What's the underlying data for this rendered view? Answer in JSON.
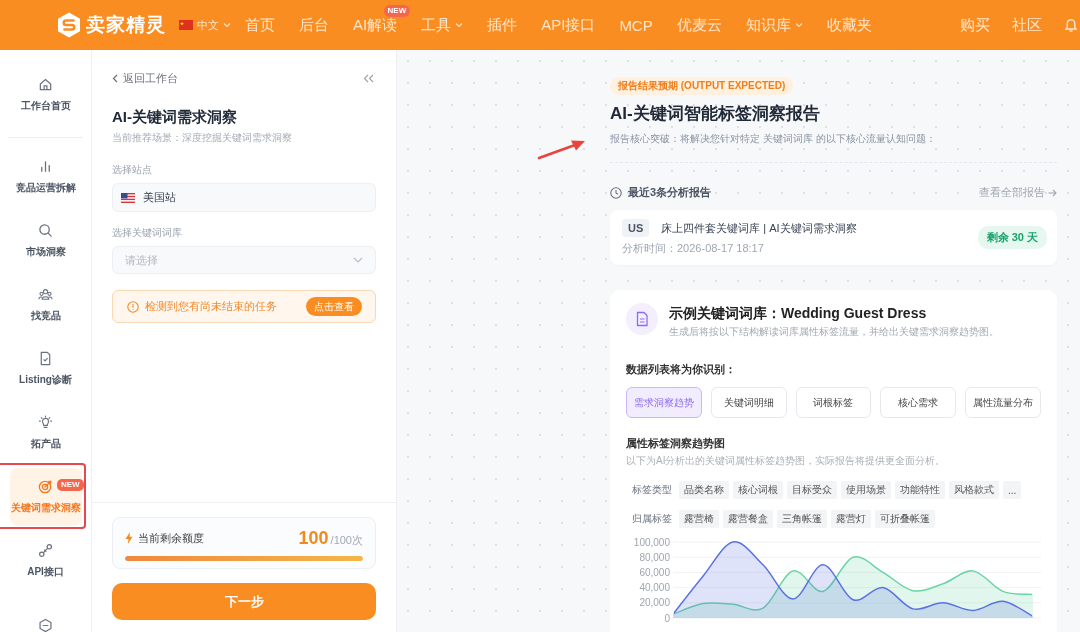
{
  "top_bar": {
    "logo_text": "卖家精灵",
    "language": "中文",
    "nav": [
      {
        "label": "首页",
        "kind": "link"
      },
      {
        "label": "后台",
        "kind": "link"
      },
      {
        "label": "AI解读",
        "kind": "link",
        "badge": "NEW"
      },
      {
        "label": "工具",
        "kind": "menu"
      },
      {
        "label": "插件",
        "kind": "link"
      },
      {
        "label": "API接口",
        "kind": "link"
      },
      {
        "label": "MCP",
        "kind": "link"
      },
      {
        "label": "优麦云",
        "kind": "link"
      },
      {
        "label": "知识库",
        "kind": "menu"
      },
      {
        "label": "收藏夹",
        "kind": "link"
      }
    ],
    "right_links": [
      "购买",
      "社区"
    ]
  },
  "sidebar": {
    "items": [
      {
        "kind": "home",
        "label": "工作台首页",
        "selected": false,
        "marked": false,
        "divider_after": true
      },
      {
        "kind": "chart",
        "label": "竞品运营拆解",
        "selected": false,
        "marked": false
      },
      {
        "kind": "search",
        "label": "市场洞察",
        "selected": false,
        "marked": false
      },
      {
        "kind": "people",
        "label": "找竞品",
        "selected": false,
        "marked": false
      },
      {
        "kind": "document",
        "label": "Listing诊断",
        "selected": false,
        "marked": false
      },
      {
        "kind": "bulb",
        "label": "拓产品",
        "selected": false,
        "marked": false
      },
      {
        "kind": "target",
        "label": "关键词需求洞察",
        "badge": "NEW",
        "selected": true,
        "marked": true
      },
      {
        "kind": "link",
        "label": "API接口",
        "selected": false,
        "marked": false
      },
      {
        "kind": "hexagon",
        "selected": false,
        "marked": false
      }
    ]
  },
  "panel": {
    "back_link": "返回工作台",
    "title": "AI-关键词需求洞察",
    "subtitle": "当前推荐场景：深度挖掘关键词需求洞察",
    "fields": [
      {
        "kind": "site",
        "label": "选择站点",
        "value": "美国站"
      },
      {
        "kind": "dropdown",
        "label": "选择关键词词库",
        "placeholder": "请选择"
      }
    ],
    "notice": {
      "text": "检测到您有尚未结束的任务",
      "button": "点击查看"
    },
    "quota": {
      "label": "当前剩余额度",
      "value": "100",
      "total": "/100次",
      "level": 1
    },
    "next_button": "下一步"
  },
  "report": {
    "badge": "报告结果预期 (OUTPUT EXPECTED)",
    "title": "AI-关键词智能标签洞察报告",
    "subtitle": "报告核心突破：将解决您针对特定 关键词词库 的以下核心流量认知问题：",
    "marked": true,
    "recent": {
      "title": "最近3条分析报告",
      "link": "查看全部报告",
      "items": [
        {
          "site": "US",
          "name": "床上四件套关键词库 | AI关键词需求洞察",
          "time": "分析时间：2026-08-17 18:17",
          "remaining": "剩余 30 天"
        }
      ]
    },
    "example": {
      "title": "示例关键词词库：Wedding Guest Dress",
      "subtitle": "生成后将按以下结构解读词库属性标签流量，并给出关键需求洞察趋势图。",
      "list_title": "数据列表将为你识别：",
      "tabs": [
        {
          "label": "需求洞察趋势",
          "selected": true
        },
        {
          "label": "关键词明细",
          "selected": false
        },
        {
          "label": "词根标签",
          "selected": false
        },
        {
          "label": "核心需求",
          "selected": false
        },
        {
          "label": "属性流量分布",
          "selected": false
        }
      ],
      "chart_title": "属性标签洞察趋势图",
      "chart_subtitle": "以下为AI分析出的关键词属性标签趋势图，实际报告将提供更全面分析。",
      "filters": [
        {
          "label": "标签类型",
          "chips": [
            "品类名称",
            "核心词根",
            "目标受众",
            "使用场景",
            "功能特性",
            "风格款式",
            "..."
          ]
        },
        {
          "label": "归属标签",
          "chips": [
            "露营椅",
            "露营餐盒",
            "三角帐篷",
            "露营灯",
            "可折叠帐篷"
          ]
        }
      ],
      "chart_data": {
        "type": "area",
        "grid": true,
        "ylim": [
          0,
          100000
        ],
        "yticks": [
          {
            "value": 0,
            "label": "0"
          },
          {
            "value": 20000,
            "label": "20,000"
          },
          {
            "value": 40000,
            "label": "40,000"
          },
          {
            "value": 60000,
            "label": "60,000"
          },
          {
            "value": 80000,
            "label": "80,000"
          },
          {
            "value": 100000,
            "label": "100,000"
          }
        ],
        "series": [
          {
            "color": "#6ad4a4",
            "values": [
              5000,
              19000,
              18000,
              13000,
              62000,
              35000,
              80000,
              60000,
              36000,
              45000,
              62000,
              35000,
              31000
            ]
          },
          {
            "color": "#5b72e3",
            "values": [
              5000,
              55000,
              100000,
              70000,
              25000,
              70000,
              24000,
              40000,
              12000,
              20000,
              10000,
              22000,
              2000
            ]
          }
        ]
      }
    }
  }
}
